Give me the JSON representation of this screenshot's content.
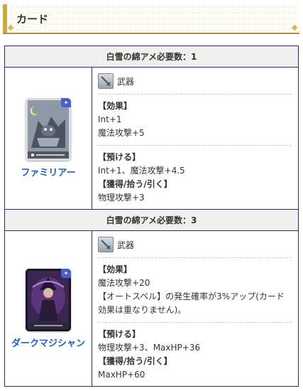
{
  "header": {
    "title": "カード"
  },
  "sections": [
    {
      "requirement": "白雪の綿アメ必要数：1",
      "card_name": "ファミリアー",
      "type_label": "武器",
      "effect_label": "【効果】",
      "effect_lines": [
        "Int+1",
        "魔法攻撃+5"
      ],
      "deposit_label": "【預ける】",
      "deposit_lines": [
        "Int+1、魔法攻撃+4.5"
      ],
      "obtain_label": "【獲得/拾う/引く】",
      "obtain_lines": [
        "物理攻撃+3"
      ]
    },
    {
      "requirement": "白雪の綿アメ必要数：3",
      "card_name": "ダークマジシャン",
      "type_label": "武器",
      "effect_label": "【効果】",
      "effect_lines": [
        "魔法攻撃+20",
        "【オートスペル】の発生確率が3%アップ(カード",
        "効果は重なりません)。"
      ],
      "deposit_label": "【預ける】",
      "deposit_lines": [
        "物理攻撃+3、MaxHP+36"
      ],
      "obtain_label": "【獲得/拾う/引く】",
      "obtain_lines": [
        "MaxHP+60"
      ]
    }
  ],
  "icons": {
    "type_icon": "sword-icon",
    "card_badge": "card-type-badge-icon"
  },
  "colors": {
    "link": "#1f5fc2",
    "border": "#2e2f54",
    "header_accent": "#c9a93e"
  }
}
